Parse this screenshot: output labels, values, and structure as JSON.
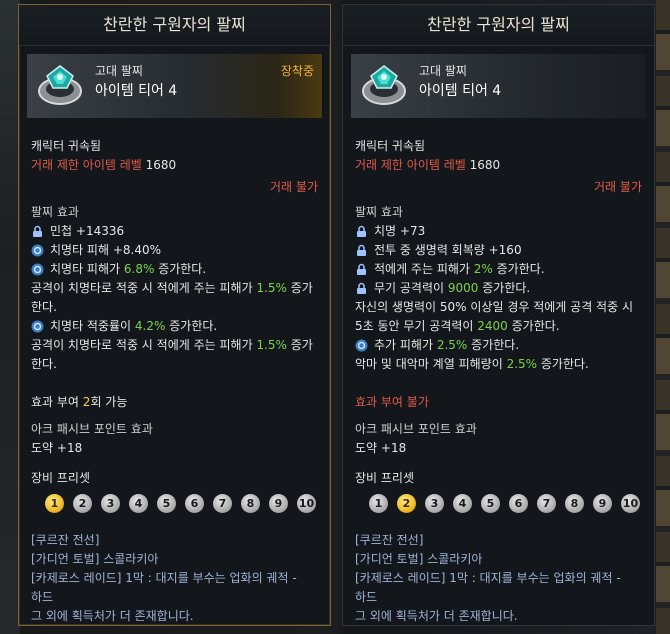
{
  "left": {
    "title": "찬란한 구원자의 팔찌",
    "grade": "고대 팔찌",
    "tier": "아이템 티어 4",
    "equipped": "장착중",
    "bound": "캐릭터 귀속됨",
    "trade_level_label": "거래 제한 아이템 레벨",
    "trade_level": "1680",
    "trade_status": "거래 불가",
    "effects_title": "팔찌 효과",
    "effects": [
      {
        "icon": "lock-icon",
        "text": "민첩 +14336"
      },
      {
        "icon": "reroll-icon",
        "text": "치명타 피해 +8.40%"
      },
      {
        "icon": "reroll-icon",
        "pre": "치명타 피해가 ",
        "hl": "6.8%",
        "post": " 증가한다."
      }
    ],
    "effect_text_1a": "공격이 치명타로 적중 시 적에게 주는 피해가 ",
    "effect_text_1hl": "1.5%",
    "effect_text_1b": " 증가",
    "effect_text_1c": "한다.",
    "effect4_pre": "치명타 적중률이 ",
    "effect4_hl": "4.2%",
    "effect4_post": " 증가한다.",
    "effect_text_2a": "공격이 치명타로 적중 시 적에게 주는 피해가 ",
    "effect_text_2hl": "1.5%",
    "effect_text_2b": " 증가",
    "effect_text_2c": "한다.",
    "grant_pre": "효과 부여 ",
    "grant_count": "2",
    "grant_post": "회 가능",
    "ark_title": "아크 패시브 포인트 효과",
    "ark_value": "도약 +18",
    "preset_title": "장비 프리셋",
    "presets": [
      "1",
      "2",
      "3",
      "4",
      "5",
      "6",
      "7",
      "8",
      "9",
      "10"
    ],
    "active_preset": "1",
    "sources": [
      "[쿠르잔 전선]",
      "[가디언 토벌] 스콜라키아",
      "[카제로스 레이드] 1막 : 대지를 부수는 업화의 궤적 -",
      "하드",
      "그 외에 획득처가 더 존재합니다."
    ]
  },
  "right": {
    "title": "찬란한 구원자의 팔찌",
    "grade": "고대 팔찌",
    "tier": "아이템 티어 4",
    "bound": "캐릭터 귀속됨",
    "trade_level_label": "거래 제한 아이템 레벨",
    "trade_level": "1680",
    "trade_status": "거래 불가",
    "effects_title": "팔찌 효과",
    "e1": "치명 +73",
    "e2": "전투 중 생명력 회복량 +160",
    "e3_pre": "적에게 주는 피해가 ",
    "e3_hl": "2%",
    "e3_post": " 증가한다.",
    "e4_pre": "무기 공격력이 ",
    "e4_hl": "9000",
    "e4_post": " 증가한다.",
    "e5a": "자신의 생명력이 50% 이상일 경우 적에게 공격 적중 시",
    "e5b_pre": "5초 동안 무기 공격력이 ",
    "e5b_hl": "2400",
    "e5b_post": " 증가한다.",
    "e6_pre": "추가 피해가 ",
    "e6_hl": "2.5%",
    "e6_post": " 증가한다.",
    "e7_pre": "악마 및 대악마 계열 피해량이 ",
    "e7_hl": "2.5%",
    "e7_post": " 증가한다.",
    "grant_status": "효과 부여 불가",
    "ark_title": "아크 패시브 포인트 효과",
    "ark_value": "도약 +18",
    "preset_title": "장비 프리셋",
    "presets": [
      "1",
      "2",
      "3",
      "4",
      "5",
      "6",
      "7",
      "8",
      "9",
      "10"
    ],
    "active_preset": "2",
    "sources": [
      "[쿠르잔 전선]",
      "[가디언 토벌] 스콜라키아",
      "[카제로스 레이드] 1막 : 대지를 부수는 업화의 궤적 -",
      "하드",
      "그 외에 획득처가 더 존재합니다."
    ]
  },
  "colors": {
    "accent_gold": "#f0b437",
    "red": "#e05a48",
    "green": "#7ad24a",
    "yellow": "#f2d24a"
  }
}
